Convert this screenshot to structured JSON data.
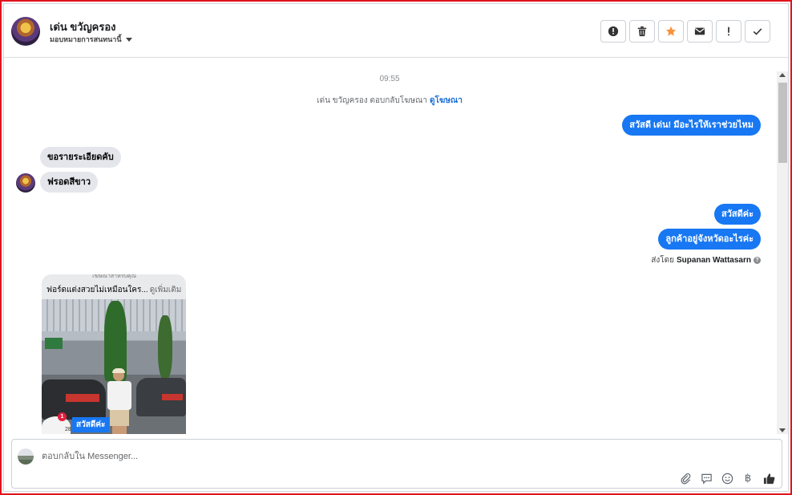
{
  "header": {
    "contact_name": "เด่น ขวัญครอง",
    "assign_label": "มอบหมายการสนทนานี้",
    "actions": [
      {
        "name": "spam-button",
        "icon": "alert-circle-icon"
      },
      {
        "name": "delete-button",
        "icon": "trash-icon"
      },
      {
        "name": "star-button",
        "icon": "star-icon"
      },
      {
        "name": "mark-unread-button",
        "icon": "envelope-icon"
      },
      {
        "name": "follow-up-button",
        "icon": "exclamation-icon"
      },
      {
        "name": "done-button",
        "icon": "check-icon"
      }
    ],
    "star_color": "#f7923b"
  },
  "conversation": {
    "timestamp": "09:55",
    "ad_reply_note": "เด่น ขวัญครอง ตอบกลับโฆษณา",
    "ad_reply_link": "ดูโฆษณา",
    "messages": {
      "out_1": "สวัสดี เด่น! มีอะไรให้เราช่วยไหม",
      "in_1": "ขอรายระเอียดคับ",
      "in_2": "ฟรอดสีขาว",
      "out_2": "สวัสดีค่ะ",
      "out_3": "ลูกค้าอยู่จังหวัดอะไรค่ะ"
    },
    "sent_by_label": "ส่งโดย",
    "sent_by_agent": "Supanan Wattasarn",
    "help_mark": "?",
    "ad_card": {
      "top_text": "โฆษณาสำหรับคุณ",
      "caption": "ฟอร์ดแต่งสวยไม่เหมือนใคร...",
      "see_more": "ดูเพิ่มเติม",
      "notification_count": "1",
      "reaction_count": "28",
      "reply_chip": "สวัสดีค่ะ"
    },
    "bubble_color": "#1877f2"
  },
  "composer": {
    "placeholder": "ตอบกลับใน Messenger...",
    "tools": [
      "paperclip-icon",
      "chat-bubble-icon",
      "emoji-icon",
      "baht-icon",
      "thumbs-up-icon"
    ],
    "baht_symbol": "฿"
  }
}
